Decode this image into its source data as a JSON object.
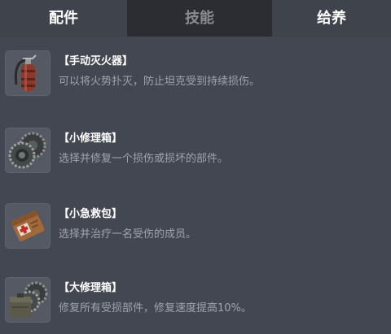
{
  "tabs": [
    {
      "label": "配件"
    },
    {
      "label": "技能"
    },
    {
      "label": "给养"
    }
  ],
  "items": [
    {
      "title": "【手动灭火器】",
      "description": "可以将火势扑灭，防止坦克受到持续损伤。",
      "icon": "fire-extinguisher-icon"
    },
    {
      "title": "【小修理箱】",
      "description": "选择并修复一个损伤或损坏的部件。",
      "icon": "small-repair-kit-icon"
    },
    {
      "title": "【小急救包】",
      "description": "选择并治疗一名受伤的成员。",
      "icon": "small-first-aid-kit-icon"
    },
    {
      "title": "【大修理箱】",
      "description": "修复所有受损部件，修复速度提高10%。",
      "icon": "large-repair-kit-icon"
    }
  ]
}
